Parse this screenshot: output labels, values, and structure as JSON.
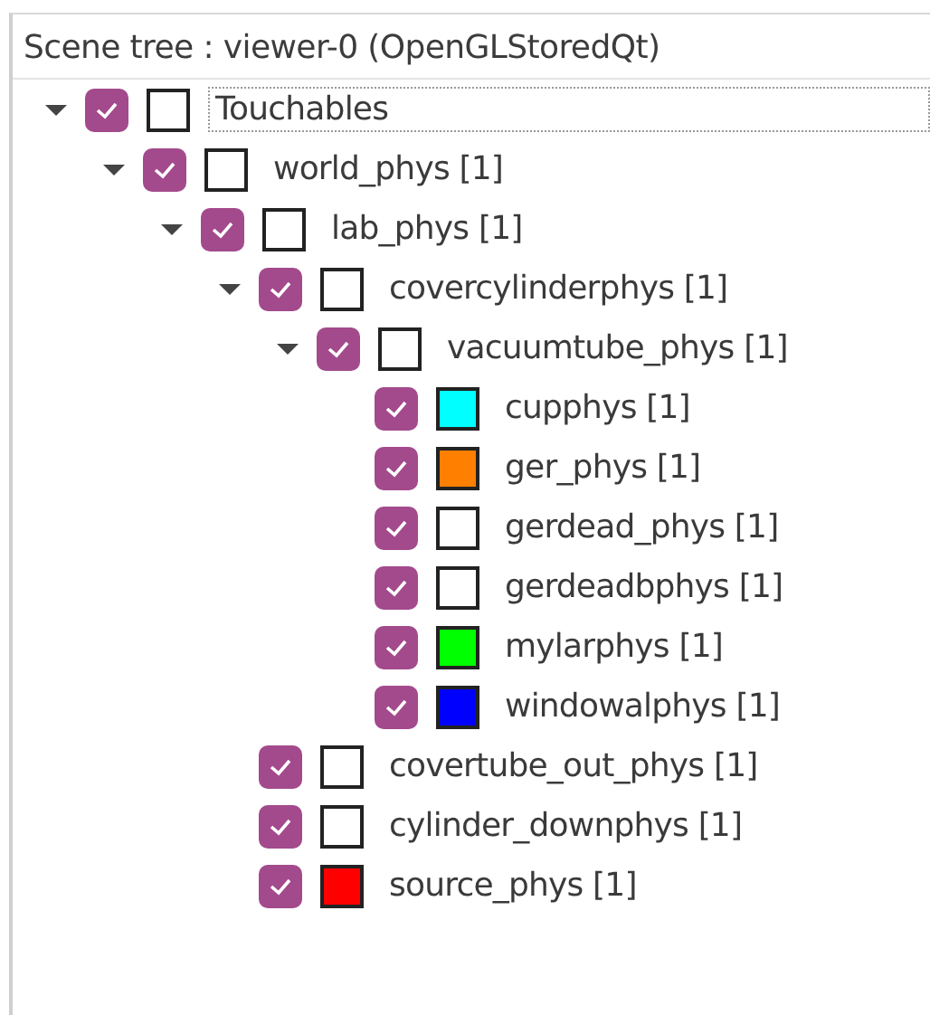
{
  "panel": {
    "title": "Scene tree : viewer-0 (OpenGLStoredQt)"
  },
  "tree": [
    {
      "label": "Touchables",
      "checked": true,
      "color": "#ffffff",
      "selected": true,
      "expanded": true,
      "children": [
        {
          "label": "world_phys [1]",
          "checked": true,
          "color": "#ffffff",
          "selected": false,
          "expanded": true,
          "children": [
            {
              "label": "lab_phys [1]",
              "checked": true,
              "color": "#ffffff",
              "selected": false,
              "expanded": true,
              "children": [
                {
                  "label": "covercylinderphys [1]",
                  "checked": true,
                  "color": "#ffffff",
                  "selected": false,
                  "expanded": true,
                  "children": [
                    {
                      "label": "vacuumtube_phys [1]",
                      "checked": true,
                      "color": "#ffffff",
                      "selected": false,
                      "expanded": true,
                      "children": [
                        {
                          "label": "cupphys [1]",
                          "checked": true,
                          "color": "#00ffff",
                          "selected": false
                        },
                        {
                          "label": "ger_phys [1]",
                          "checked": true,
                          "color": "#ff7f00",
                          "selected": false
                        },
                        {
                          "label": "gerdead_phys [1]",
                          "checked": true,
                          "color": "#ffffff",
                          "selected": false
                        },
                        {
                          "label": "gerdeadbphys [1]",
                          "checked": true,
                          "color": "#ffffff",
                          "selected": false
                        },
                        {
                          "label": "mylarphys [1]",
                          "checked": true,
                          "color": "#00ff00",
                          "selected": false
                        },
                        {
                          "label": "windowalphys [1]",
                          "checked": true,
                          "color": "#0000ff",
                          "selected": false
                        }
                      ]
                    }
                  ]
                },
                {
                  "label": "covertube_out_phys [1]",
                  "checked": true,
                  "color": "#ffffff",
                  "selected": false
                },
                {
                  "label": "cylinder_downphys [1]",
                  "checked": true,
                  "color": "#ffffff",
                  "selected": false
                },
                {
                  "label": "source_phys [1]",
                  "checked": true,
                  "color": "#ff0000",
                  "selected": false
                }
              ]
            }
          ]
        }
      ]
    }
  ]
}
